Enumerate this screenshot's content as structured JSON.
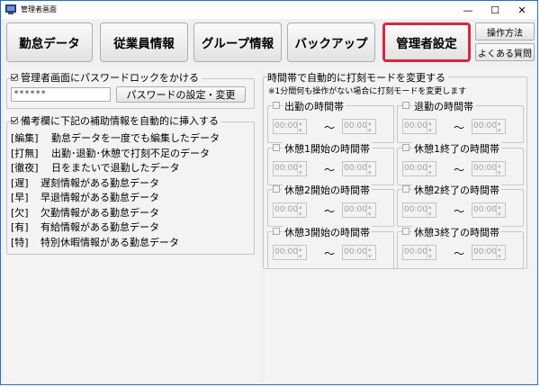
{
  "window": {
    "title": "管理者画面",
    "minimize": "—",
    "maximize": "☐",
    "close": "✕"
  },
  "nav": [
    {
      "label": "勤怠データ"
    },
    {
      "label": "従業員情報"
    },
    {
      "label": "グループ情報"
    },
    {
      "label": "バックアップ"
    },
    {
      "label": "管理者設定",
      "active": true
    }
  ],
  "help": {
    "manual": "操作方法",
    "faq": "よくある質問"
  },
  "password": {
    "checkbox_label": "管理者画面にパスワードロックをかける",
    "checked": true,
    "value": "******",
    "button": "パスワードの設定・変更"
  },
  "remarks": {
    "checkbox_label": "備考欄に下記の補助情報を自動的に挿入する",
    "checked": true,
    "items": [
      {
        "tag": "[編集]",
        "desc": "勤怠データを一度でも編集したデータ"
      },
      {
        "tag": "[打無]",
        "desc": "出勤･退勤･休憩で打刻不足のデータ"
      },
      {
        "tag": "[徹夜]",
        "desc": "日をまたいで退勤したデータ"
      },
      {
        "tag": "[遅]",
        "desc": "遅刻情報がある勤怠データ"
      },
      {
        "tag": "[早]",
        "desc": "早退情報がある勤怠データ"
      },
      {
        "tag": "[欠]",
        "desc": "欠勤情報がある勤怠データ"
      },
      {
        "tag": "[有]",
        "desc": "有給情報がある勤怠データ"
      },
      {
        "tag": "[特]",
        "desc": "特別休暇情報がある勤怠データ"
      }
    ]
  },
  "timemode": {
    "title": "時間帯で自動的に打刻モードを変更する",
    "note": "※1分間何も操作がない場合に打刻モードを変更します",
    "tilde": "〜",
    "slots": [
      {
        "label": "出勤の時間帯",
        "from": "00:00",
        "to": "00:00"
      },
      {
        "label": "退勤の時間帯",
        "from": "00:00",
        "to": "00:00"
      },
      {
        "label": "休憩1開始の時間帯",
        "from": "00:00",
        "to": "00:00"
      },
      {
        "label": "休憩1終了の時間帯",
        "from": "00:00",
        "to": "00:00"
      },
      {
        "label": "休憩2開始の時間帯",
        "from": "00:00",
        "to": "00:00"
      },
      {
        "label": "休憩2終了の時間帯",
        "from": "00:00",
        "to": "00:00"
      },
      {
        "label": "休憩3開始の時間帯",
        "from": "00:00",
        "to": "00:00"
      },
      {
        "label": "休憩3終了の時間帯",
        "from": "00:00",
        "to": "00:00"
      }
    ]
  }
}
